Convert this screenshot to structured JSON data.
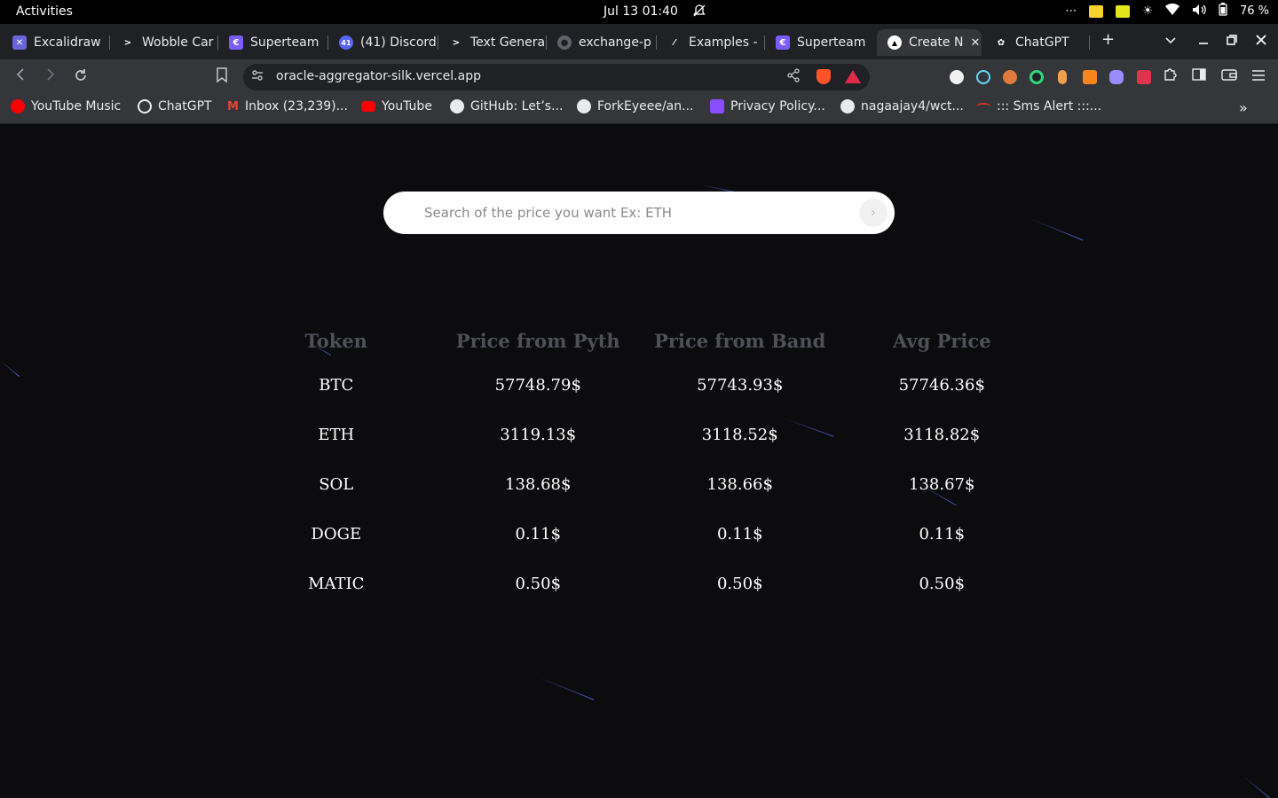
{
  "topbar": {
    "activities": "Activities",
    "clock": "Jul 13  01:40",
    "more": "⋯",
    "battery": "76 %"
  },
  "tabs": [
    {
      "title": "Excalidraw",
      "fav_color": "#6965db",
      "fav_glyph": "✕"
    },
    {
      "title": "Wobble Car",
      "fav_color": "#202124",
      "fav_glyph": ">"
    },
    {
      "title": "Superteam",
      "fav_color": "#7c5cff",
      "fav_glyph": "€"
    },
    {
      "title": "(41) Discord",
      "fav_color": "#5865f2",
      "fav_glyph": "41"
    },
    {
      "title": "Text Genera",
      "fav_color": "#202124",
      "fav_glyph": ">"
    },
    {
      "title": "exchange-p",
      "fav_color": "#5f6368",
      "fav_glyph": "●"
    },
    {
      "title": "Examples -",
      "fav_color": "#202124",
      "fav_glyph": "⁄"
    },
    {
      "title": "Superteam",
      "fav_color": "#7c5cff",
      "fav_glyph": "€"
    },
    {
      "title": "Create N",
      "fav_color": "#ffffff",
      "fav_glyph": "▲"
    },
    {
      "title": "ChatGPT",
      "fav_color": "#202124",
      "fav_glyph": "✿"
    }
  ],
  "toolbar": {
    "url": "oracle-aggregator-silk.vercel.app"
  },
  "bookmarks": [
    {
      "label": "YouTube Music",
      "color": "#ff0000"
    },
    {
      "label": "ChatGPT",
      "color": "#e8eaed"
    },
    {
      "label": "Inbox (23,239)...",
      "color": "#ea4335"
    },
    {
      "label": "YouTube",
      "color": "#ff0000"
    },
    {
      "label": "GitHub: Let’s...",
      "color": "#e8eaed"
    },
    {
      "label": "ForkEyeee/an...",
      "color": "#e8eaed"
    },
    {
      "label": "Privacy Policy...",
      "color": "#8a4dff"
    },
    {
      "label": "nagaajay4/wct...",
      "color": "#e8eaed"
    },
    {
      "label": "::: Sms Alert :::...",
      "color": "#d93025"
    }
  ],
  "search": {
    "placeholder": "Search of the price you want Ex: ETH",
    "go_icon": "›"
  },
  "table": {
    "headers": [
      "Token",
      "Price from Pyth",
      "Price from Band",
      "Avg Price"
    ],
    "rows": [
      [
        "BTC",
        "57748.79$",
        "57743.93$",
        "57746.36$"
      ],
      [
        "ETH",
        "3119.13$",
        "3118.52$",
        "3118.82$"
      ],
      [
        "SOL",
        "138.68$",
        "138.66$",
        "138.67$"
      ],
      [
        "DOGE",
        "0.11$",
        "0.11$",
        "0.11$"
      ],
      [
        "MATIC",
        "0.50$",
        "0.50$",
        "0.50$"
      ]
    ]
  }
}
